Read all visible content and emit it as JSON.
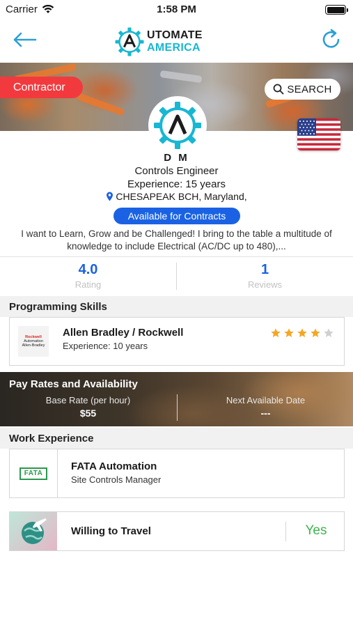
{
  "status_bar": {
    "carrier": "Carrier",
    "time": "1:58 PM"
  },
  "header": {
    "logo_word1": "UTOMATE",
    "logo_word2": "AMERICA"
  },
  "banner": {
    "badge": "Contractor",
    "search_label": "SEARCH"
  },
  "profile": {
    "name": "D M",
    "title": "Controls Engineer",
    "experience": "Experience: 15 years",
    "location": "CHESAPEAK BCH, Maryland,",
    "availability": "Available for Contracts",
    "bio": "I want to Learn, Grow and be Challenged! I bring to the table a multitude of knowledge to include Electrical (AC/DC up to 480),..."
  },
  "stats": {
    "rating_value": "4.0",
    "rating_label": "Rating",
    "reviews_value": "1",
    "reviews_label": "Reviews"
  },
  "programming_skills": {
    "heading": "Programming Skills",
    "items": [
      {
        "logo_line1": "Rockwell",
        "logo_line2": "Automation",
        "logo_line3": "Allen-Bradley",
        "name": "Allen Bradley / Rockwell",
        "experience": "Experience: 10 years",
        "stars": 4,
        "max_stars": 5
      }
    ]
  },
  "pay_rates": {
    "heading": "Pay Rates and Availability",
    "base_rate_label": "Base Rate (per hour)",
    "base_rate_value": "$55",
    "next_date_label": "Next Available Date",
    "next_date_value": "---"
  },
  "work_experience": {
    "heading": "Work Experience",
    "items": [
      {
        "logo_text": "FATA",
        "company": "FATA Automation",
        "role": "Site Controls Manager"
      }
    ]
  },
  "travel": {
    "label": "Willing to Travel",
    "value": "Yes"
  },
  "colors": {
    "accent_blue": "#1a62e3",
    "contractor_red": "#f23a3e",
    "brand_cyan": "#18b7d2",
    "star_orange": "#f5a623",
    "yes_green": "#3fb34f"
  }
}
